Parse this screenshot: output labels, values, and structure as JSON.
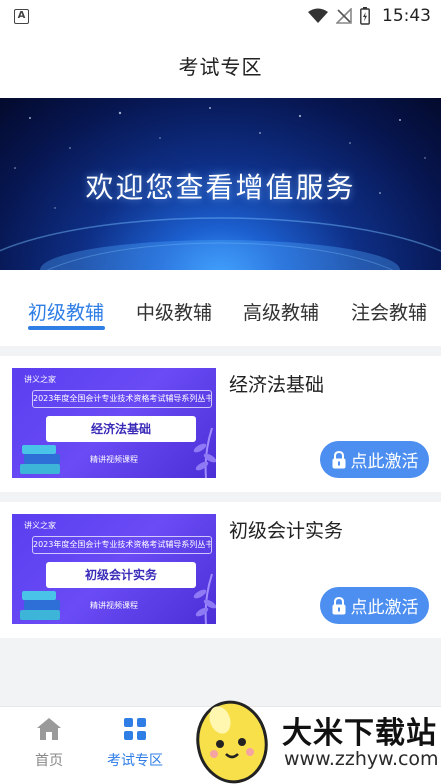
{
  "status_bar": {
    "time": "15:43",
    "left_icon": "a-notification-icon",
    "icons": [
      "wifi-icon",
      "signal-off-icon",
      "battery-charging-icon"
    ]
  },
  "header": {
    "title": "考试专区"
  },
  "banner": {
    "text": "欢迎您查看增值服务"
  },
  "tabs": [
    {
      "label": "初级教辅",
      "active": true
    },
    {
      "label": "中级教辅",
      "active": false
    },
    {
      "label": "高级教辅",
      "active": false
    },
    {
      "label": "注会教辅",
      "active": false
    }
  ],
  "courses": [
    {
      "name": "经济法基础",
      "cover": {
        "series": "2023年度全国会计专业技术资格考试辅导系列丛书",
        "title": "经济法基础",
        "subtitle": "精讲视频课程"
      },
      "button_label": "点此激活"
    },
    {
      "name": "初级会计实务",
      "cover": {
        "series": "2023年度全国会计专业技术资格考试辅导系列丛书",
        "title": "初级会计实务",
        "subtitle": "精讲视频课程"
      },
      "button_label": "点此激活"
    }
  ],
  "bottom_nav": [
    {
      "label": "首页",
      "icon": "home-icon",
      "active": false
    },
    {
      "label": "考试专区",
      "icon": "grid-icon",
      "active": true
    }
  ],
  "watermark": {
    "title": "大米下载站",
    "url": "www.zzhyw.com"
  },
  "colors": {
    "accent": "#2f7ee6",
    "button": "#4d8ff0",
    "cover": "#5a3ff0"
  }
}
